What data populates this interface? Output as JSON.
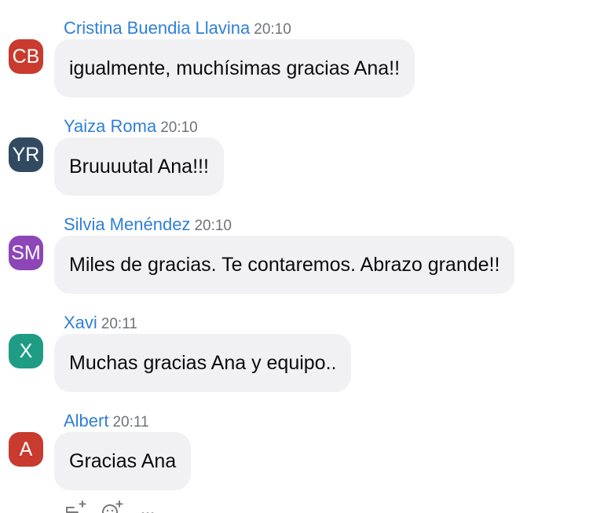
{
  "colors": {
    "sender_name": "#2f7fd6",
    "time": "#6f7378",
    "bubble_background": "#f1f1f4",
    "message_text": "#0b0b0b"
  },
  "messages": [
    {
      "avatar_initials": "CB",
      "avatar_color": "#c83b2e",
      "sender": "Cristina Buendia Llavina",
      "time": "20:10",
      "text": "igualmente, muchísimas gracias Ana!!"
    },
    {
      "avatar_initials": "YR",
      "avatar_color": "#324a61",
      "sender": "Yaiza Roma",
      "time": "20:10",
      "text": "Bruuuutal Ana!!!"
    },
    {
      "avatar_initials": "SM",
      "avatar_color": "#8c46b7",
      "sender": "Silvia Menéndez",
      "time": "20:10",
      "text": "Miles de gracias. Te contaremos. Abrazo grande!!"
    },
    {
      "avatar_initials": "X",
      "avatar_color": "#1e9d84",
      "sender": "Xavi",
      "time": "20:11",
      "text": "Muchas gracias Ana y equipo.."
    },
    {
      "avatar_initials": "A",
      "avatar_color": "#c83b2e",
      "sender": "Albert",
      "time": "20:11",
      "text": "Gracias Ana"
    }
  ],
  "message_actions": [
    {
      "icon": "reply-add-icon"
    },
    {
      "icon": "emoji-reaction-icon"
    },
    {
      "icon": "more-options-icon"
    }
  ]
}
